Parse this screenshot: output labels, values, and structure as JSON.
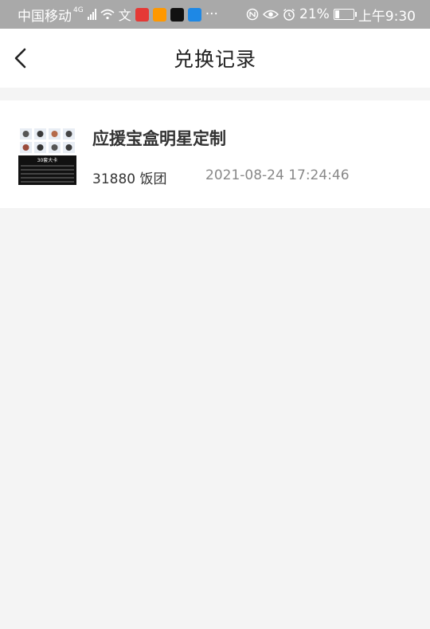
{
  "statusbar": {
    "carrier": "中国移动",
    "network": "4G",
    "battery_percent": "21%",
    "battery_level": 0.21,
    "time": "上午9:30",
    "more": "···"
  },
  "header": {
    "title": "兑换记录",
    "back_icon": "chevron-left-icon"
  },
  "records": [
    {
      "name": "应援宝盒明星定制",
      "points": "31880 饭团",
      "time": "2021-08-24 17:24:46",
      "thumb_caption": "30套大卡"
    }
  ],
  "colors": {
    "statusbar_bg": "#a9a9a9",
    "page_bg": "#f4f4f4",
    "card_bg": "#ffffff",
    "title_text": "#222222",
    "muted_text": "#888888"
  }
}
